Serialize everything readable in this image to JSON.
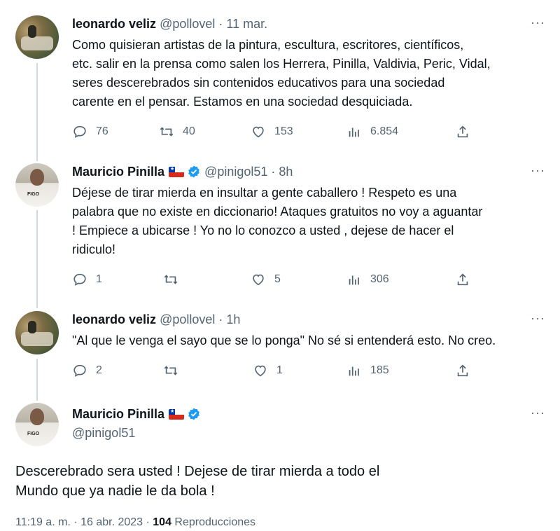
{
  "tweets": [
    {
      "name": "leonardo veliz",
      "handle": "@pollovel",
      "time": "11 mar.",
      "text_lines": [
        "Como quisieran artistas de la pintura, escultura, escritores, científicos,",
        "etc. salir en la prensa como salen los Herrera, Pinilla, Valdivia, Peric, Vidal,",
        "seres descerebrados sin contenidos educativos para una sociedad",
        "carente en el pensar. Estamos en una sociedad desquiciada."
      ],
      "replies": "76",
      "retweets": "40",
      "likes": "153",
      "views": "6.854"
    },
    {
      "name": "Mauricio Pinilla",
      "handle": "@pinigol51",
      "time": "8h",
      "text_lines": [
        "Déjese de tirar mierda en insultar a gente caballero ! Respeto es una",
        "palabra que no existe en diccionario! Ataques gratuitos no voy a aguantar",
        "! Empiece a ubicarse ! Yo no lo conozco a usted , dejese de hacer el",
        "ridiculo!"
      ],
      "replies": "1",
      "retweets": "",
      "likes": "5",
      "views": "306"
    },
    {
      "name": "leonardo veliz",
      "handle": "@pollovel",
      "time": "1h",
      "text_lines": [
        "\"Al que le venga el sayo que se lo ponga\" No sé si entenderá esto. No creo."
      ],
      "replies": "2",
      "retweets": "",
      "likes": "1",
      "views": "185"
    }
  ],
  "main_tweet": {
    "name": "Mauricio Pinilla",
    "handle": "@pinigol51",
    "text_lines": [
      "Descerebrado sera usted ! Dejese de tirar mierda a todo el",
      "Mundo que ya nadie le da bola !"
    ],
    "timestamp": "11:19 a. m. · 16 abr. 2023 · ",
    "views_count": "104",
    "views_label": "Reproducciones"
  },
  "ui": {
    "separator": "·",
    "more_label": "···"
  },
  "colors": {
    "secondary_text": "#536471",
    "primary_text": "#0f1419",
    "verified_blue": "#1d9bf0",
    "thread_line": "#cfd9de"
  }
}
